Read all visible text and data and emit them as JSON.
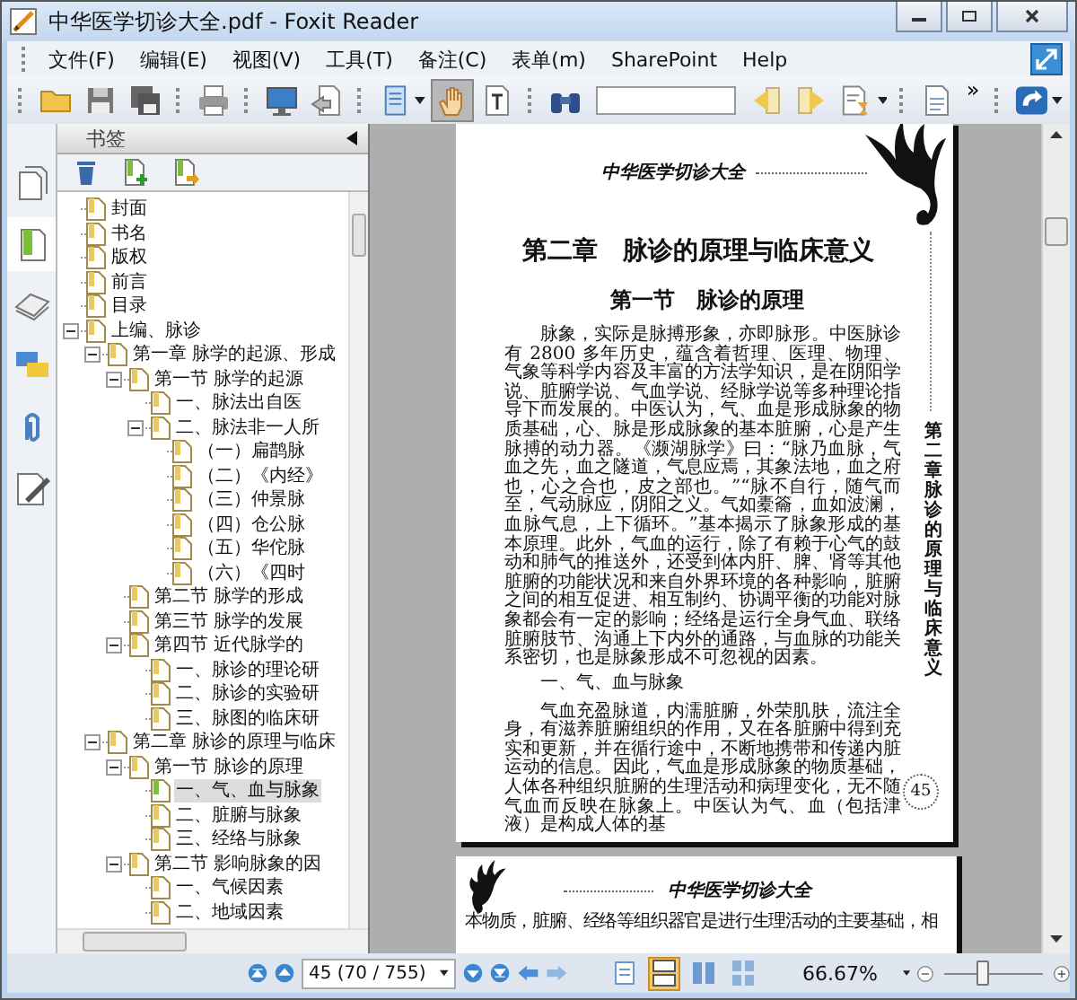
{
  "window": {
    "title": "中华医学切诊大全.pdf - Foxit Reader"
  },
  "menu": [
    {
      "label": "文件(F)"
    },
    {
      "label": "编辑(E)"
    },
    {
      "label": "视图(V)"
    },
    {
      "label": "工具(T)"
    },
    {
      "label": "备注(C)"
    },
    {
      "label": "表单(m)"
    },
    {
      "label": "SharePoint"
    },
    {
      "label": "Help"
    }
  ],
  "toolbar": {
    "groups": [
      {
        "items": [
          {
            "kind": "folder",
            "selected": false
          },
          {
            "kind": "floppy",
            "selected": false
          },
          {
            "kind": "floppy-stack",
            "selected": false
          }
        ]
      },
      {
        "items": [
          {
            "kind": "printer",
            "selected": false
          }
        ]
      },
      {
        "items": [
          {
            "kind": "monitor",
            "selected": false
          },
          {
            "kind": "doc-arrow",
            "selected": false
          }
        ]
      },
      {
        "items": [
          {
            "kind": "page",
            "selected": false,
            "dropdown": true
          },
          {
            "kind": "hand",
            "selected": true
          },
          {
            "kind": "text-select",
            "selected": false
          }
        ]
      },
      {
        "items": [
          {
            "kind": "binoculars",
            "selected": false
          },
          {
            "kind": "search-field"
          },
          {
            "kind": "find-prev",
            "selected": false
          },
          {
            "kind": "find-next",
            "selected": false
          },
          {
            "kind": "doc-hourglass",
            "selected": false,
            "dropdown": true
          }
        ]
      },
      {
        "items": [
          {
            "kind": "doc-text",
            "selected": false
          },
          {
            "kind": "overflow",
            "label": "»"
          }
        ]
      },
      {
        "items": [
          {
            "kind": "update",
            "selected": false,
            "dropdown": true
          }
        ]
      }
    ]
  },
  "sidebar": {
    "title": "书签",
    "tabs": [
      {
        "kind": "pages",
        "selected": false
      },
      {
        "kind": "bookmarks",
        "selected": true
      },
      {
        "kind": "layers",
        "selected": false
      },
      {
        "kind": "comments",
        "selected": false
      },
      {
        "kind": "attachments",
        "selected": false
      },
      {
        "kind": "signatures",
        "selected": false
      }
    ],
    "tree": [
      {
        "label": "封面",
        "selected": false
      },
      {
        "label": "书名",
        "selected": false
      },
      {
        "label": "版权",
        "selected": false
      },
      {
        "label": "前言",
        "selected": false
      },
      {
        "label": "目录",
        "selected": false
      },
      {
        "label": "上编、脉诊",
        "selected": false,
        "expanded": true,
        "children": [
          {
            "label": "第一章 脉学的起源、形成",
            "selected": false,
            "expanded": true,
            "children": [
              {
                "label": "第一节 脉学的起源",
                "selected": false,
                "expanded": true,
                "children": [
                  {
                    "label": "一、脉法出自医",
                    "selected": false
                  },
                  {
                    "label": "二、脉法非一人所",
                    "selected": false,
                    "expanded": true,
                    "children": [
                      {
                        "label": "（一）扁鹊脉",
                        "selected": false
                      },
                      {
                        "label": "（二）《内经》",
                        "selected": false
                      },
                      {
                        "label": "（三）仲景脉",
                        "selected": false
                      },
                      {
                        "label": "（四）仓公脉",
                        "selected": false
                      },
                      {
                        "label": "（五）华佗脉",
                        "selected": false
                      },
                      {
                        "label": "（六）《四时",
                        "selected": false
                      }
                    ]
                  }
                ]
              },
              {
                "label": "第二节 脉学的形成",
                "selected": false
              },
              {
                "label": "第三节 脉学的发展",
                "selected": false
              },
              {
                "label": "第四节 近代脉学的",
                "selected": false,
                "expanded": true,
                "children": [
                  {
                    "label": "一、脉诊的理论研",
                    "selected": false
                  },
                  {
                    "label": "二、脉诊的实验研",
                    "selected": false
                  },
                  {
                    "label": "三、脉图的临床研",
                    "selected": false
                  }
                ]
              }
            ]
          },
          {
            "label": "第二章 脉诊的原理与临床",
            "selected": false,
            "expanded": true,
            "children": [
              {
                "label": "第一节 脉诊的原理",
                "selected": false,
                "expanded": true,
                "children": [
                  {
                    "label": "一、气、血与脉象",
                    "selected": true
                  },
                  {
                    "label": "二、脏腑与脉象",
                    "selected": false
                  },
                  {
                    "label": "三、经络与脉象",
                    "selected": false
                  }
                ]
              },
              {
                "label": "第二节 影响脉象的因",
                "selected": false,
                "expanded": true,
                "children": [
                  {
                    "label": "一、气候因素",
                    "selected": false
                  },
                  {
                    "label": "二、地域因素",
                    "selected": false
                  }
                ]
              }
            ]
          }
        ]
      }
    ]
  },
  "document": {
    "page": {
      "running_header": "中华医学切诊大全",
      "chapter_title": "第二章　脉诊的原理与临床意义",
      "section_title": "第一节　脉诊的原理",
      "blocks": [
        {
          "kind": "paragraph",
          "text": "脉象，实际是脉搏形象，亦即脉形。中医脉诊有 2800 多年历史，蕴含着哲理、医理、物理、气象等科学内容及丰富的方法学知识，是在阴阳学说、脏腑学说、气血学说、经脉学说等多种理论指导下而发展的。中医认为，气、血是形成脉象的物质基础，心、脉是形成脉象的基本脏腑，心是产生脉搏的动力器。《濒湖脉学》曰：“脉乃血脉，气血之先，血之隧道，气息应焉，其象法地，血之府也，心之合也，皮之部也。”“脉不自行，随气而至，气动脉应，阴阳之义。气如橐籥，血如波澜，血脉气息，上下循环。”基本揭示了脉象形成的基本原理。此外，气血的运行，除了有赖于心气的鼓动和肺气的推送外，还受到体内肝、脾、肾等其他脏腑的功能状况和来自外界环境的各种影响，脏腑之间的相互促进、相互制约、协调平衡的功能对脉象都会有一定的影响；经络是运行全身气血、联络脏腑肢节、沟通上下内外的通路，与血脉的功能关系密切，也是脉象形成不可忽视的因素。"
        },
        {
          "kind": "heading",
          "text": "一、气、血与脉象"
        },
        {
          "kind": "paragraph",
          "text": "气血充盈脉道，内濡脏腑，外荣肌肤，流注全身，有滋养脏腑组织的作用，又在各脏腑中得到充实和更新，并在循行途中，不断地携带和传递内脏运动的信息。因此，气血是形成脉象的物质基础，人体各种组织脏腑的生理活动和病理变化，无不随气血而反映在脉象上。中医认为气、血（包括津液）是构成人体的基"
        }
      ],
      "side_title": "第二章脉诊的原理与临床意义",
      "page_number": "45"
    },
    "next_page": {
      "running_header": "中华医学切诊大全",
      "text": "本物质，脏腑、经络等组织器官是进行生理活动的主要基础，相"
    }
  },
  "status_bar": {
    "page_field": "45 (70 / 755)",
    "view_modes": [
      {
        "kind": "single",
        "selected": false
      },
      {
        "kind": "continuous",
        "selected": true
      },
      {
        "kind": "facing",
        "selected": false
      },
      {
        "kind": "continuous-facing",
        "selected": false
      }
    ],
    "zoom": "66.67%",
    "zoom_slider": {
      "level": 0.37
    }
  }
}
